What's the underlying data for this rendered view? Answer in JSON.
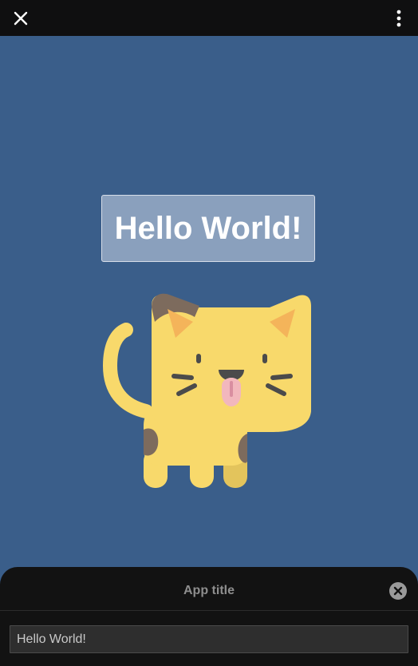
{
  "topbar": {
    "close_icon": "close-icon",
    "menu_icon": "vertical-dots-icon"
  },
  "stage": {
    "background": "#3a5e8a",
    "hello_text": "Hello World!",
    "illustration": "cat-illustration"
  },
  "sheet": {
    "title": "App title",
    "close_icon": "circle-close-icon",
    "input_value": "Hello World!"
  },
  "colors": {
    "stage_bg": "#3a5e8a",
    "sheet_bg": "#121212",
    "cat_body": "#f8d96b",
    "cat_spots": "#7d6b5d",
    "cat_ears": "#f4b45a",
    "cat_tongue": "#f2b7bd"
  }
}
